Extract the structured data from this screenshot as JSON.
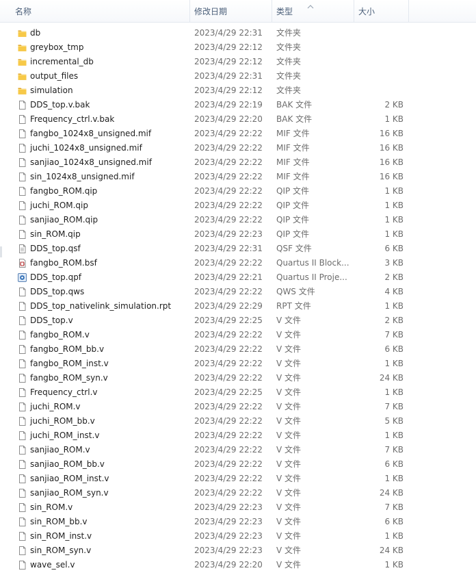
{
  "columns": {
    "name": "名称",
    "date": "修改日期",
    "type": "类型",
    "size": "大小"
  },
  "files": [
    {
      "name": "db",
      "date": "2023/4/29 22:31",
      "type": "文件夹",
      "size": "",
      "icon": "folder-icon"
    },
    {
      "name": "greybox_tmp",
      "date": "2023/4/29 22:12",
      "type": "文件夹",
      "size": "",
      "icon": "folder-icon"
    },
    {
      "name": "incremental_db",
      "date": "2023/4/29 22:12",
      "type": "文件夹",
      "size": "",
      "icon": "folder-icon"
    },
    {
      "name": "output_files",
      "date": "2023/4/29 22:31",
      "type": "文件夹",
      "size": "",
      "icon": "folder-icon"
    },
    {
      "name": "simulation",
      "date": "2023/4/29 22:12",
      "type": "文件夹",
      "size": "",
      "icon": "folder-icon"
    },
    {
      "name": "DDS_top.v.bak",
      "date": "2023/4/29 22:19",
      "type": "BAK 文件",
      "size": "2 KB",
      "icon": "file-icon"
    },
    {
      "name": "Frequency_ctrl.v.bak",
      "date": "2023/4/29 22:20",
      "type": "BAK 文件",
      "size": "1 KB",
      "icon": "file-icon"
    },
    {
      "name": "fangbo_1024x8_unsigned.mif",
      "date": "2023/4/29 22:22",
      "type": "MIF 文件",
      "size": "16 KB",
      "icon": "file-icon"
    },
    {
      "name": "juchi_1024x8_unsigned.mif",
      "date": "2023/4/29 22:22",
      "type": "MIF 文件",
      "size": "16 KB",
      "icon": "file-icon"
    },
    {
      "name": "sanjiao_1024x8_unsigned.mif",
      "date": "2023/4/29 22:22",
      "type": "MIF 文件",
      "size": "16 KB",
      "icon": "file-icon"
    },
    {
      "name": "sin_1024x8_unsigned.mif",
      "date": "2023/4/29 22:22",
      "type": "MIF 文件",
      "size": "16 KB",
      "icon": "file-icon"
    },
    {
      "name": "fangbo_ROM.qip",
      "date": "2023/4/29 22:22",
      "type": "QIP 文件",
      "size": "1 KB",
      "icon": "file-icon"
    },
    {
      "name": "juchi_ROM.qip",
      "date": "2023/4/29 22:22",
      "type": "QIP 文件",
      "size": "1 KB",
      "icon": "file-icon"
    },
    {
      "name": "sanjiao_ROM.qip",
      "date": "2023/4/29 22:22",
      "type": "QIP 文件",
      "size": "1 KB",
      "icon": "file-icon"
    },
    {
      "name": "sin_ROM.qip",
      "date": "2023/4/29 22:23",
      "type": "QIP 文件",
      "size": "1 KB",
      "icon": "file-icon"
    },
    {
      "name": "DDS_top.qsf",
      "date": "2023/4/29 22:31",
      "type": "QSF 文件",
      "size": "6 KB",
      "icon": "text-file-icon"
    },
    {
      "name": "fangbo_ROM.bsf",
      "date": "2023/4/29 22:22",
      "type": "Quartus II Block...",
      "size": "3 KB",
      "icon": "block-file-icon"
    },
    {
      "name": "DDS_top.qpf",
      "date": "2023/4/29 22:21",
      "type": "Quartus II Proje...",
      "size": "2 KB",
      "icon": "project-file-icon"
    },
    {
      "name": "DDS_top.qws",
      "date": "2023/4/29 22:22",
      "type": "QWS 文件",
      "size": "4 KB",
      "icon": "file-icon"
    },
    {
      "name": "DDS_top_nativelink_simulation.rpt",
      "date": "2023/4/29 22:29",
      "type": "RPT 文件",
      "size": "1 KB",
      "icon": "file-icon"
    },
    {
      "name": "DDS_top.v",
      "date": "2023/4/29 22:25",
      "type": "V 文件",
      "size": "2 KB",
      "icon": "file-icon"
    },
    {
      "name": "fangbo_ROM.v",
      "date": "2023/4/29 22:22",
      "type": "V 文件",
      "size": "7 KB",
      "icon": "file-icon"
    },
    {
      "name": "fangbo_ROM_bb.v",
      "date": "2023/4/29 22:22",
      "type": "V 文件",
      "size": "6 KB",
      "icon": "file-icon"
    },
    {
      "name": "fangbo_ROM_inst.v",
      "date": "2023/4/29 22:22",
      "type": "V 文件",
      "size": "1 KB",
      "icon": "file-icon"
    },
    {
      "name": "fangbo_ROM_syn.v",
      "date": "2023/4/29 22:22",
      "type": "V 文件",
      "size": "24 KB",
      "icon": "file-icon"
    },
    {
      "name": "Frequency_ctrl.v",
      "date": "2023/4/29 22:25",
      "type": "V 文件",
      "size": "1 KB",
      "icon": "file-icon"
    },
    {
      "name": "juchi_ROM.v",
      "date": "2023/4/29 22:22",
      "type": "V 文件",
      "size": "7 KB",
      "icon": "file-icon"
    },
    {
      "name": "juchi_ROM_bb.v",
      "date": "2023/4/29 22:22",
      "type": "V 文件",
      "size": "5 KB",
      "icon": "file-icon"
    },
    {
      "name": "juchi_ROM_inst.v",
      "date": "2023/4/29 22:22",
      "type": "V 文件",
      "size": "1 KB",
      "icon": "file-icon"
    },
    {
      "name": "sanjiao_ROM.v",
      "date": "2023/4/29 22:22",
      "type": "V 文件",
      "size": "7 KB",
      "icon": "file-icon"
    },
    {
      "name": "sanjiao_ROM_bb.v",
      "date": "2023/4/29 22:22",
      "type": "V 文件",
      "size": "6 KB",
      "icon": "file-icon"
    },
    {
      "name": "sanjiao_ROM_inst.v",
      "date": "2023/4/29 22:22",
      "type": "V 文件",
      "size": "1 KB",
      "icon": "file-icon"
    },
    {
      "name": "sanjiao_ROM_syn.v",
      "date": "2023/4/29 22:22",
      "type": "V 文件",
      "size": "24 KB",
      "icon": "file-icon"
    },
    {
      "name": "sin_ROM.v",
      "date": "2023/4/29 22:23",
      "type": "V 文件",
      "size": "7 KB",
      "icon": "file-icon"
    },
    {
      "name": "sin_ROM_bb.v",
      "date": "2023/4/29 22:23",
      "type": "V 文件",
      "size": "6 KB",
      "icon": "file-icon"
    },
    {
      "name": "sin_ROM_inst.v",
      "date": "2023/4/29 22:23",
      "type": "V 文件",
      "size": "1 KB",
      "icon": "file-icon"
    },
    {
      "name": "sin_ROM_syn.v",
      "date": "2023/4/29 22:23",
      "type": "V 文件",
      "size": "24 KB",
      "icon": "file-icon"
    },
    {
      "name": "wave_sel.v",
      "date": "2023/4/29 22:20",
      "type": "V 文件",
      "size": "1 KB",
      "icon": "file-icon"
    }
  ]
}
